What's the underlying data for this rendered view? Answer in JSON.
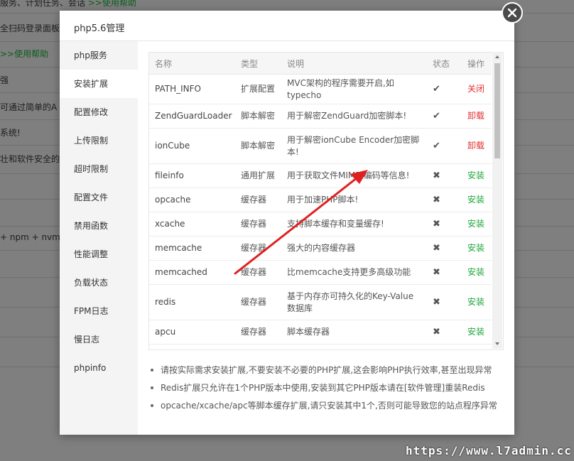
{
  "background": {
    "lines": [
      {
        "text": "服务、计划任务、会话 ",
        "link": ">>使用帮助"
      },
      {
        "text": "全扫码登录面板",
        "link": ""
      },
      {
        "text": "",
        "link": ">>使用帮助"
      },
      {
        "text": "强",
        "link": ""
      },
      {
        "text": "可通过简单的A",
        "link": ""
      },
      {
        "text": "系统!",
        "link": ""
      },
      {
        "text": "壮和软件安全的",
        "link": ""
      },
      {
        "text": "+ npm + nvm",
        "link": ""
      }
    ]
  },
  "modal": {
    "title": "php5.6管理",
    "sidebar": [
      "php服务",
      "安装扩展",
      "配置修改",
      "上传限制",
      "超时限制",
      "配置文件",
      "禁用函数",
      "性能调整",
      "负载状态",
      "FPM日志",
      "慢日志",
      "phpinfo"
    ],
    "table": {
      "headers": [
        "名称",
        "类型",
        "说明",
        "状态",
        "操作"
      ],
      "rows": [
        {
          "name": "PATH_INFO",
          "type": "扩展配置",
          "desc": "MVC架构的程序需要开启,如typecho",
          "status": "✔",
          "op": "关闭",
          "op_class": "op-close"
        },
        {
          "name": "ZendGuardLoader",
          "type": "脚本解密",
          "desc": "用于解密ZendGuard加密脚本!",
          "status": "✔",
          "op": "卸载",
          "op_class": "op-uninstall"
        },
        {
          "name": "ionCube",
          "type": "脚本解密",
          "desc": "用于解密ionCube Encoder加密脚本!",
          "status": "✔",
          "op": "卸载",
          "op_class": "op-uninstall"
        },
        {
          "name": "fileinfo",
          "type": "通用扩展",
          "desc": "用于获取文件MIME,编码等信息!",
          "status": "✖",
          "op": "安装",
          "op_class": "op-install"
        },
        {
          "name": "opcache",
          "type": "缓存器",
          "desc": "用于加速PHP脚本!",
          "status": "✖",
          "op": "安装",
          "op_class": "op-install"
        },
        {
          "name": "xcache",
          "type": "缓存器",
          "desc": "支持脚本缓存和变量缓存!",
          "status": "✖",
          "op": "安装",
          "op_class": "op-install"
        },
        {
          "name": "memcache",
          "type": "缓存器",
          "desc": "强大的内容缓存器",
          "status": "✖",
          "op": "安装",
          "op_class": "op-install"
        },
        {
          "name": "memcached",
          "type": "缓存器",
          "desc": "比memcache支持更多高级功能",
          "status": "✖",
          "op": "安装",
          "op_class": "op-install"
        },
        {
          "name": "redis",
          "type": "缓存器",
          "desc": "基于内存亦可持久化的Key-Value数据库",
          "status": "✖",
          "op": "安装",
          "op_class": "op-install"
        },
        {
          "name": "apcu",
          "type": "缓存器",
          "desc": "脚本缓存器",
          "status": "✖",
          "op": "安装",
          "op_class": "op-install"
        }
      ]
    },
    "notes": [
      "请按实际需求安装扩展,不要安装不必要的PHP扩展,这会影响PHP执行效率,甚至出现异常",
      "Redis扩展只允许在1个PHP版本中使用,安装到其它PHP版本请在[软件管理]重装Redis",
      "opcache/xcache/apc等脚本缓存扩展,请只安装其中1个,否则可能导致您的站点程序异常"
    ]
  },
  "watermark": "https://www.l7admin.cc",
  "colors": {
    "install": "#20a53a",
    "uninstall": "#e03131",
    "arrow": "#e02020"
  }
}
